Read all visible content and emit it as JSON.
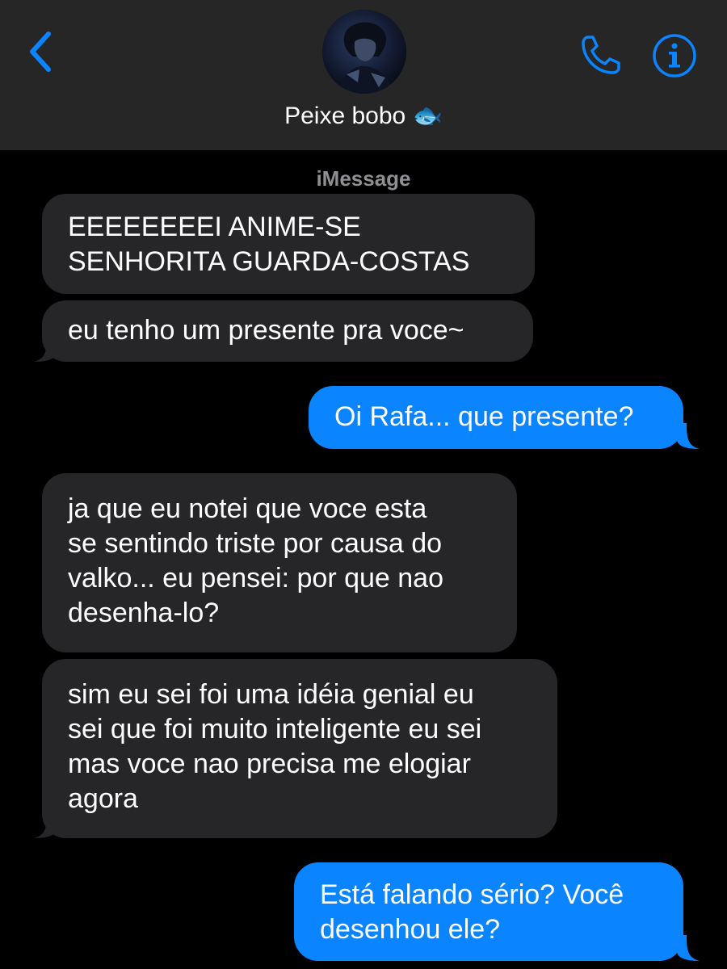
{
  "header": {
    "contact_name": "Peixe bobo 🐟",
    "service_label": "iMessage"
  },
  "icons": {
    "back": "chevron-left-icon",
    "call": "phone-icon",
    "info": "info-icon"
  },
  "colors": {
    "header_bg": "#262626",
    "accent": "#0a84ff",
    "incoming_bubble": "#262628",
    "outgoing_bubble": "#0a84ff"
  },
  "messages": [
    {
      "direction": "incoming",
      "lines": [
        "EEEEEEEEI ANIME-SE",
        "SENHORITA GUARDA-COSTAS"
      ]
    },
    {
      "direction": "incoming",
      "lines": [
        "eu tenho um presente pra voce~"
      ]
    },
    {
      "direction": "outgoing",
      "lines": [
        "Oi Rafa... que presente?"
      ]
    },
    {
      "direction": "incoming",
      "lines": [
        "ja que eu notei que voce esta",
        "se sentindo triste por causa do",
        "valko... eu pensei: por que nao",
        "desenha-lo?"
      ]
    },
    {
      "direction": "incoming",
      "lines": [
        "sim eu sei foi uma idéia genial eu",
        "sei que foi muito inteligente eu sei",
        "mas voce nao precisa me elogiar",
        "agora"
      ]
    },
    {
      "direction": "outgoing",
      "lines": [
        "Está falando sério? Você",
        "desenhou ele?"
      ]
    }
  ]
}
